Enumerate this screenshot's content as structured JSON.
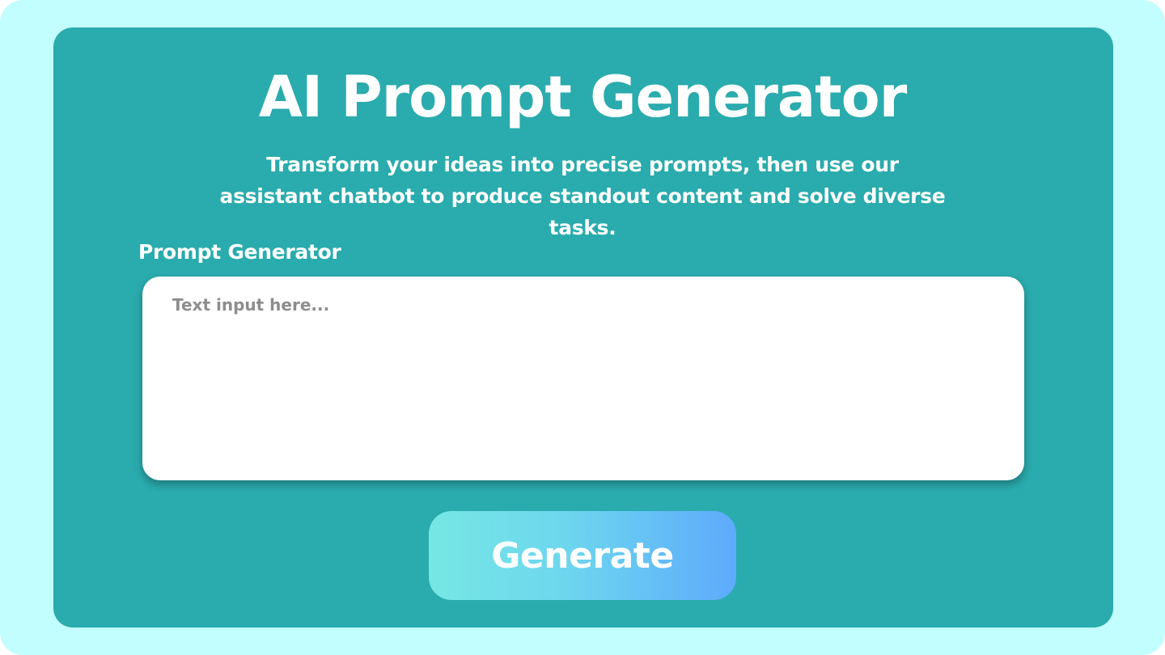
{
  "header": {
    "title": "AI Prompt Generator",
    "subtitle": "Transform your ideas into precise prompts, then use our assistant chatbot to produce standout content and solve diverse tasks."
  },
  "prompt_section": {
    "label": "Prompt Generator",
    "input_value": "",
    "input_placeholder": "Text input here..."
  },
  "actions": {
    "generate_label": "Generate"
  },
  "colors": {
    "page_background": "#c2fefe",
    "card_background": "#2aabad",
    "button_gradient_start": "#76e7e4",
    "button_gradient_end": "#5eaafc",
    "text_primary": "#ffffff",
    "placeholder_text": "#8d8d8d"
  }
}
